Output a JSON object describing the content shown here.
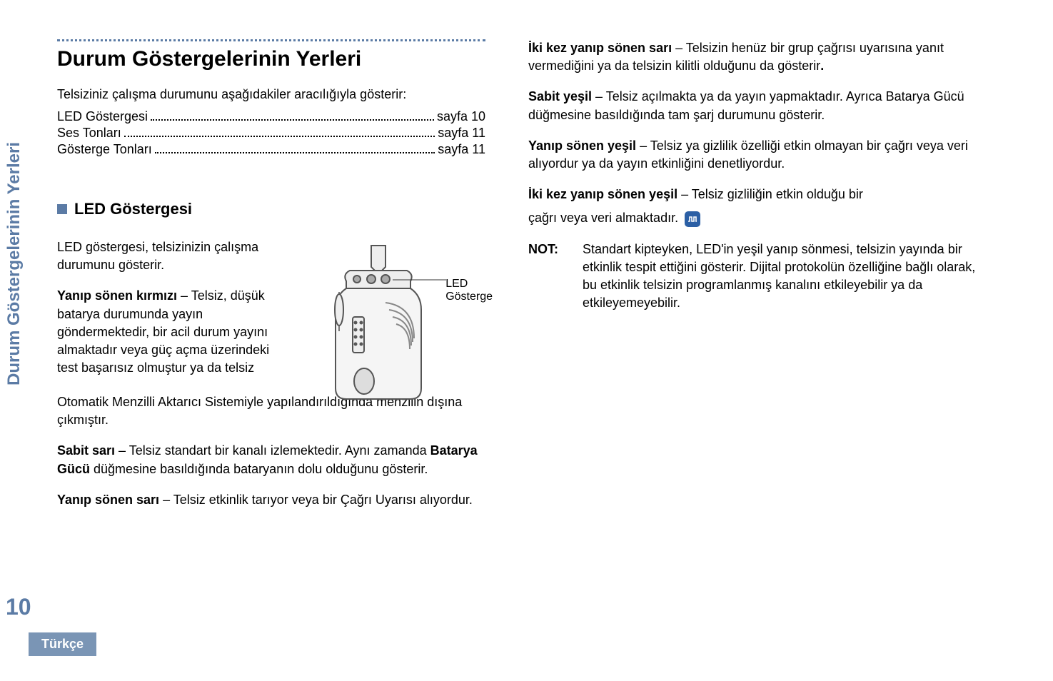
{
  "sidebar": {
    "vertical_title": "Durum Göstergelerinin Yerleri",
    "page_number": "10",
    "language": "Türkçe"
  },
  "left": {
    "heading": "Durum Göstergelerinin Yerleri",
    "intro": "Telsiziniz çalışma durumunu aşağıdakiler aracılığıyla gösterir:",
    "toc": [
      {
        "label": "LED Göstergesi",
        "page": "sayfa 10"
      },
      {
        "label": "Ses Tonları",
        "page": "sayfa 11"
      },
      {
        "label": "Gösterge Tonları",
        "page": "sayfa 11"
      }
    ],
    "sub_heading": "LED Göstergesi",
    "led_intro": "LED göstergesi, telsizinizin çalışma durumunu gösterir.",
    "callout_line1": "LED",
    "callout_line2": "Gösterge",
    "p_red_label": "Yanıp sönen kırmızı",
    "p_red_body": " – Telsiz, düşük batarya durumunda yayın göndermektedir, bir acil durum yayını almaktadır veya güç açma üzerindeki test başarısız olmuştur ya da telsiz Otomatik Menzilli Aktarıcı Sistemiyle yapılandırıldığında menzilin dışına çıkmıştır.",
    "p_solid_yellow_label": "Sabit sarı",
    "p_solid_yellow_body_1": " – Telsiz standart bir kanalı izlemektedir. Aynı zamanda ",
    "p_solid_yellow_body_2": "Batarya Gücü",
    "p_solid_yellow_body_3": " düğmesine basıldığında bataryanın dolu olduğunu gösterir.",
    "p_blink_yellow_label": "Yanıp sönen sarı",
    "p_blink_yellow_body": " – Telsiz etkinlik tarıyor veya bir Çağrı Uyarısı alıyordur."
  },
  "right": {
    "p_dbl_yellow_label": "İki kez yanıp sönen sarı",
    "p_dbl_yellow_body": " – Telsizin henüz bir grup çağrısı uyarısına yanıt vermediğini ya da telsizin kilitli olduğunu da gösterir",
    "p_dbl_yellow_end": ".",
    "p_solid_green_label": "Sabit yeşil",
    "p_solid_green_body": " – Telsiz açılmakta ya da yayın yapmaktadır. Ayrıca Batarya Gücü düğmesine basıldığında tam şarj durumunu gösterir.",
    "p_blink_green_label": "Yanıp sönen yeşil",
    "p_blink_green_body": " – Telsiz ya gizlilik özelliği etkin olmayan bir çağrı veya veri alıyordur ya da yayın etkinliğini denetliyordur.",
    "p_dbl_green_label": "İki kez yanıp sönen yeşil",
    "p_dbl_green_body_1": " – Telsiz gizliliğin etkin olduğu bir",
    "p_dbl_green_body_2": "çağrı veya veri almaktadır.",
    "note_label": "NOT:",
    "note_body": "Standart kipteyken, LED'in yeşil yanıp sönmesi, telsizin yayında bir etkinlik tespit ettiğini gösterir. Dijital protokolün özelliğine bağlı olarak, bu etkinlik telsizin programlanmış kanalını etkileyebilir ya da etkileyemeyebilir."
  }
}
